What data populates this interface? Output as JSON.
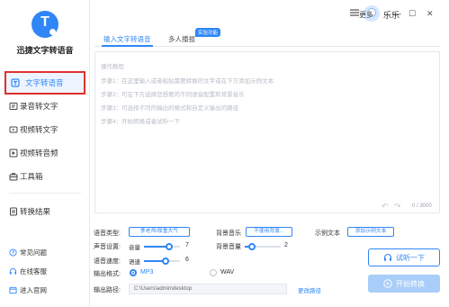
{
  "app": {
    "name": "迅捷文字转语音"
  },
  "user": {
    "name": "乐乐"
  },
  "window": {
    "more_label": "更多",
    "minimize": "—",
    "maximize": "☐",
    "close": "✕"
  },
  "sidebar": {
    "items": [
      {
        "label": "文字转语音",
        "icon": "text-to-speech-icon"
      },
      {
        "label": "录音转文字",
        "icon": "recording-icon"
      },
      {
        "label": "视频转文字",
        "icon": "video-icon"
      },
      {
        "label": "视频转音频",
        "icon": "video-audio-icon"
      },
      {
        "label": "工具箱",
        "icon": "toolbox-icon"
      }
    ],
    "results": {
      "label": "转换结果",
      "icon": "result-icon"
    },
    "bottom": [
      {
        "label": "常见问题",
        "icon": "question-icon"
      },
      {
        "label": "在线客服",
        "icon": "service-icon"
      },
      {
        "label": "进入官网",
        "icon": "website-icon"
      }
    ]
  },
  "tabs": [
    {
      "label": "输入文字转语音"
    },
    {
      "label": "多人播报",
      "badge": "实验功能"
    }
  ],
  "editor": {
    "lines": [
      "操作教程",
      "步骤1：在这里输入或者粘贴需要转换的文字或在下方添加示例文本",
      "步骤2：可在下方选择您想要的不同语音配置和背景音乐",
      "步骤3：可选择不同的输出的格式和自定义输出的路径",
      "步骤4：开始转换或者试听一下"
    ],
    "undo": "↶",
    "redo": "↷",
    "count": "0 / 3000"
  },
  "settings": {
    "voice_type": {
      "label": "语音类型:",
      "value": "季老师/厚重大气"
    },
    "bg_music": {
      "label": "背景音乐",
      "value": "不使用背景..."
    },
    "sample_text": {
      "label": "示例文本",
      "value": "添加示例文本"
    },
    "voice_setting": {
      "label": "声音设置:",
      "volume_label": "音量",
      "volume_value": "7",
      "volume_level": 0.7
    },
    "bg_volume": {
      "label": "背景音量",
      "value": "2",
      "level": 0.2
    },
    "speed": {
      "label": "语音速度:",
      "sub_label": "语速",
      "value": "6",
      "level": 0.6
    },
    "format": {
      "label": "输出格式:",
      "options": [
        "MP3",
        "WAV"
      ],
      "selected": "MP3"
    },
    "path": {
      "label": "输出路径:",
      "value": "C:\\Users\\admin\\desktop",
      "change_label": "更改路径"
    }
  },
  "actions": {
    "try_label": "试听一下",
    "start_label": "开始转换"
  },
  "colors": {
    "accent": "#2f86f6",
    "highlight_border": "#e02f2f",
    "disabled_button": "#a9cdf9"
  }
}
